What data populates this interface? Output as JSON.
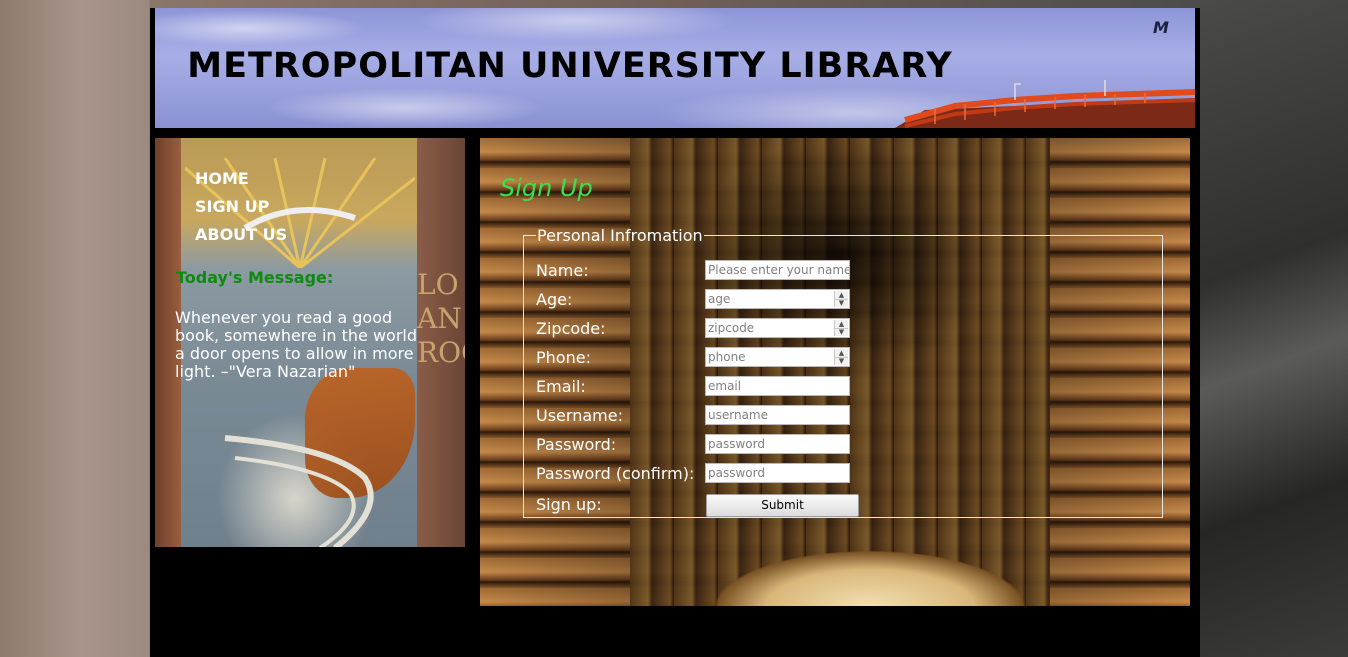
{
  "banner": {
    "title": "METROPOLITAN UNIVERSITY LIBRARY",
    "logo_text": "M"
  },
  "sidebar": {
    "nav": [
      "HOME",
      "SIGN UP",
      "ABOUT US"
    ],
    "message_title": "Today's Message:",
    "message_body": "Whenever you read a good book, somewhere in the world a door opens to allow in more light. –\"Vera Nazarian\"",
    "book_spine_text": "LO AN ROC"
  },
  "main": {
    "heading": "Sign Up",
    "fieldset_legend": "Personal Infromation",
    "fields": [
      {
        "label": "Name:",
        "placeholder": "Please enter your name.",
        "type": "text"
      },
      {
        "label": "Age:",
        "placeholder": "age",
        "type": "number"
      },
      {
        "label": "Zipcode:",
        "placeholder": "zipcode",
        "type": "number"
      },
      {
        "label": "Phone:",
        "placeholder": "phone",
        "type": "number"
      },
      {
        "label": "Email:",
        "placeholder": "email",
        "type": "text"
      },
      {
        "label": "Username:",
        "placeholder": "username",
        "type": "text"
      },
      {
        "label": "Password:",
        "placeholder": "password",
        "type": "password"
      },
      {
        "label": "Password (confirm):",
        "placeholder": "password",
        "type": "password"
      }
    ],
    "submit_label": "Sign up:",
    "submit_button": "Submit"
  },
  "colors": {
    "heading_green": "#38e24a",
    "message_green": "#0e8a0e",
    "page_bg": "#000000",
    "banner_sky": "#a7aee6"
  }
}
